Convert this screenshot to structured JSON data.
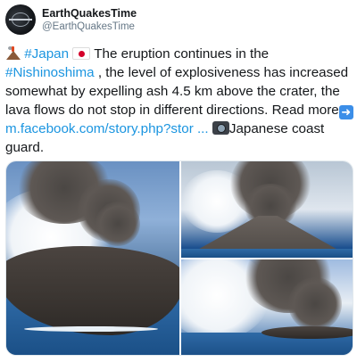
{
  "account": {
    "display_name": "EarthQuakesTime",
    "handle": "@EarthQuakesTime"
  },
  "tweet": {
    "hashtag_japan": "#Japan",
    "text_1": " The eruption continues in the ",
    "hashtag_place": "#Nishinoshima",
    "text_2": " , the level of explosiveness has increased somewhat by expelling ash 4.5 km above the crater, the lava flows do not stop in different directions. Read more",
    "link": "m.facebook.com/story.php?stor ...",
    "credit": "Japanese coast guard."
  },
  "icons": {
    "avatar": "earthquakestime-logo",
    "volcano": "volcano-emoji",
    "flag": "japan-flag-emoji",
    "arrow": "right-arrow-emoji",
    "camera": "camera-emoji"
  },
  "colors": {
    "link": "#1b95e0",
    "text": "#14171a",
    "muted": "#657786"
  },
  "media": {
    "photos": [
      {
        "subject": "aerial-volcano-island-plume"
      },
      {
        "subject": "volcano-cone-ash-column"
      },
      {
        "subject": "eruption-steam-over-sea"
      }
    ]
  }
}
